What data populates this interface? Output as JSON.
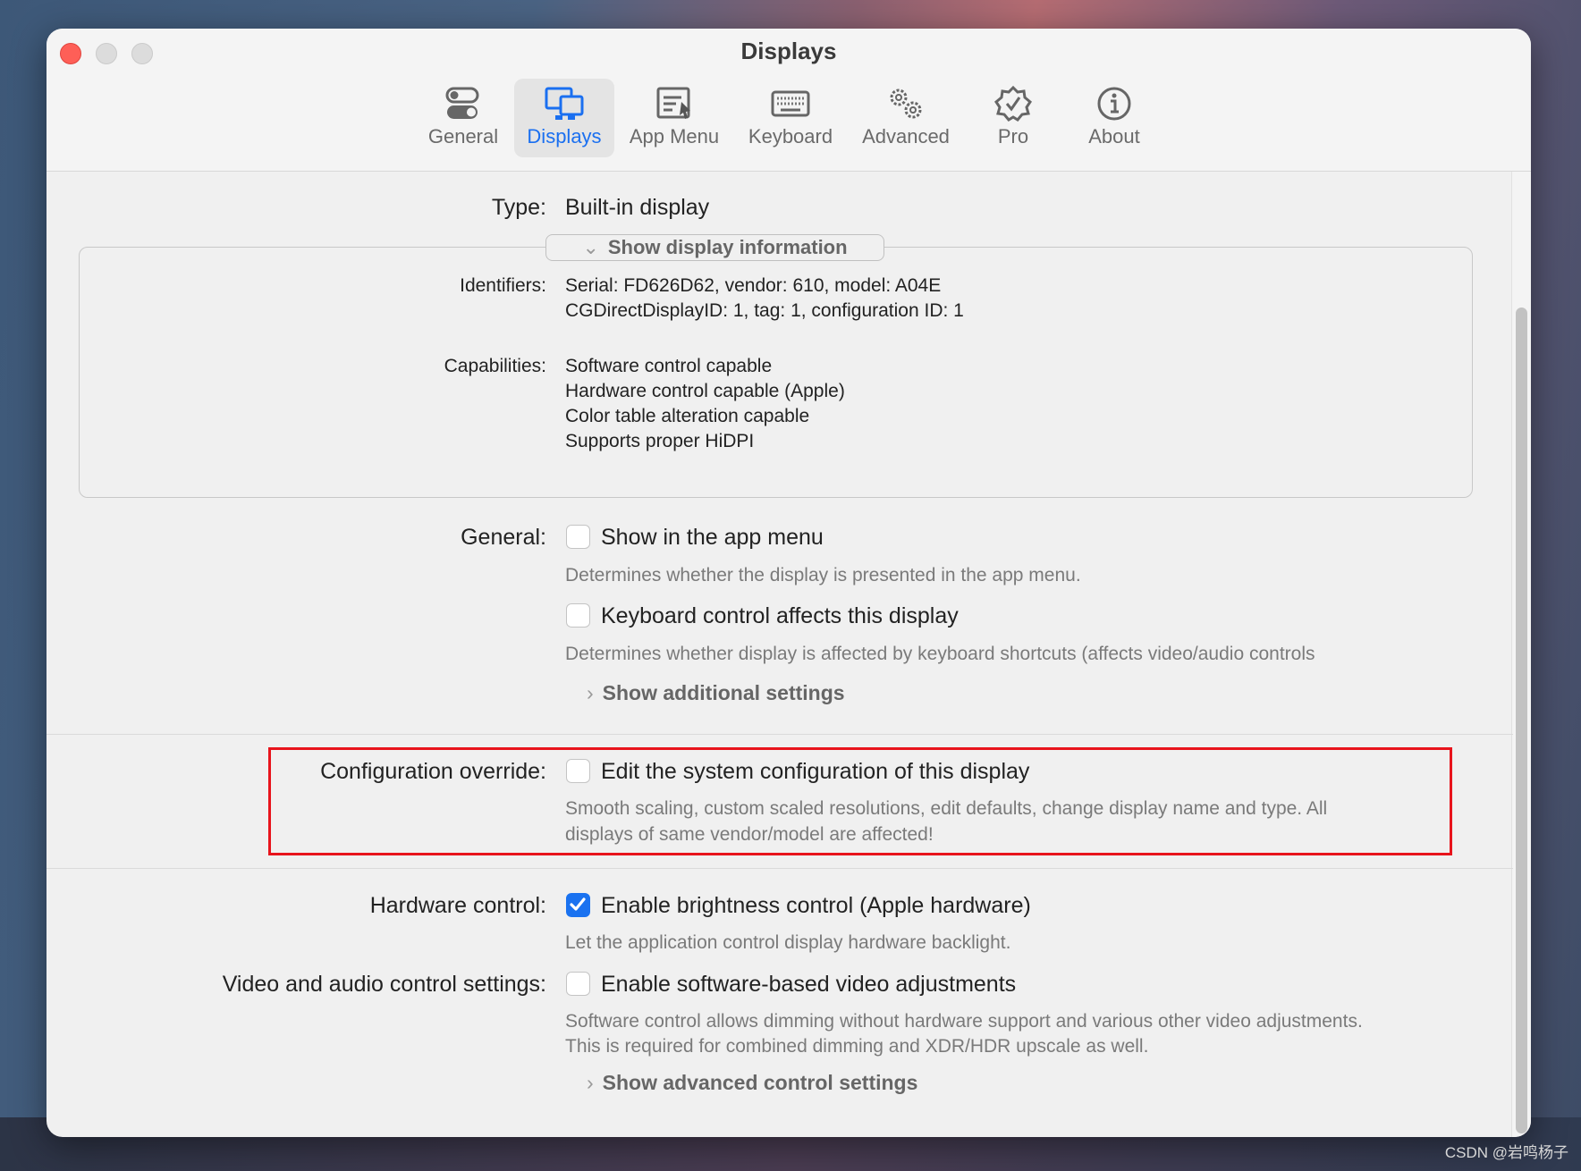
{
  "window": {
    "title": "Displays"
  },
  "toolbar": {
    "tabs": [
      {
        "label": "General",
        "icon": "toggle-switches-icon"
      },
      {
        "label": "Displays",
        "icon": "displays-icon",
        "selected": true
      },
      {
        "label": "App Menu",
        "icon": "app-menu-icon"
      },
      {
        "label": "Keyboard",
        "icon": "keyboard-icon"
      },
      {
        "label": "Advanced",
        "icon": "gears-icon"
      },
      {
        "label": "Pro",
        "icon": "checkmark-seal-icon"
      },
      {
        "label": "About",
        "icon": "info-icon"
      }
    ]
  },
  "display": {
    "type_label": "Type:",
    "type_value": "Built-in display",
    "info_toggle": "Show display information",
    "identifiers_label": "Identifiers:",
    "identifiers": [
      "Serial: FD626D62, vendor: 610, model: A04E",
      "CGDirectDisplayID: 1, tag: 1, configuration ID: 1"
    ],
    "capabilities_label": "Capabilities:",
    "capabilities": [
      "Software control capable",
      "Hardware control capable (Apple)",
      "Color table alteration capable",
      "Supports proper HiDPI"
    ]
  },
  "general": {
    "label": "General:",
    "show_in_menu": {
      "label": "Show in the app menu",
      "checked": false,
      "desc": "Determines whether the display is presented in the app menu."
    },
    "keyboard_control": {
      "label": "Keyboard control affects this display",
      "checked": false,
      "desc": "Determines whether display is affected by keyboard shortcuts (affects video/audio controls"
    },
    "additional": "Show additional settings"
  },
  "config": {
    "label": "Configuration override:",
    "option": "Edit the system configuration of this display",
    "checked": false,
    "desc": [
      "Smooth scaling, custom scaled resolutions, edit defaults, change display name and type. All",
      "displays of same vendor/model are affected!"
    ],
    "highlight_color": "#e8141c"
  },
  "hardware": {
    "label": "Hardware control:",
    "option": "Enable brightness control (Apple hardware)",
    "checked": true,
    "desc": "Let the application control display hardware backlight."
  },
  "video": {
    "label": "Video and audio control settings:",
    "option": "Enable software-based video adjustments",
    "checked": false,
    "desc": [
      "Software control allows dimming without hardware support and  various other video adjustments.",
      "This is required for combined dimming and XDR/HDR upscale as well."
    ],
    "advanced": "Show advanced control settings"
  },
  "watermark": "CSDN @岩鸣杨子",
  "colors": {
    "accent": "#1a72f0",
    "close": "#fe5f57"
  }
}
